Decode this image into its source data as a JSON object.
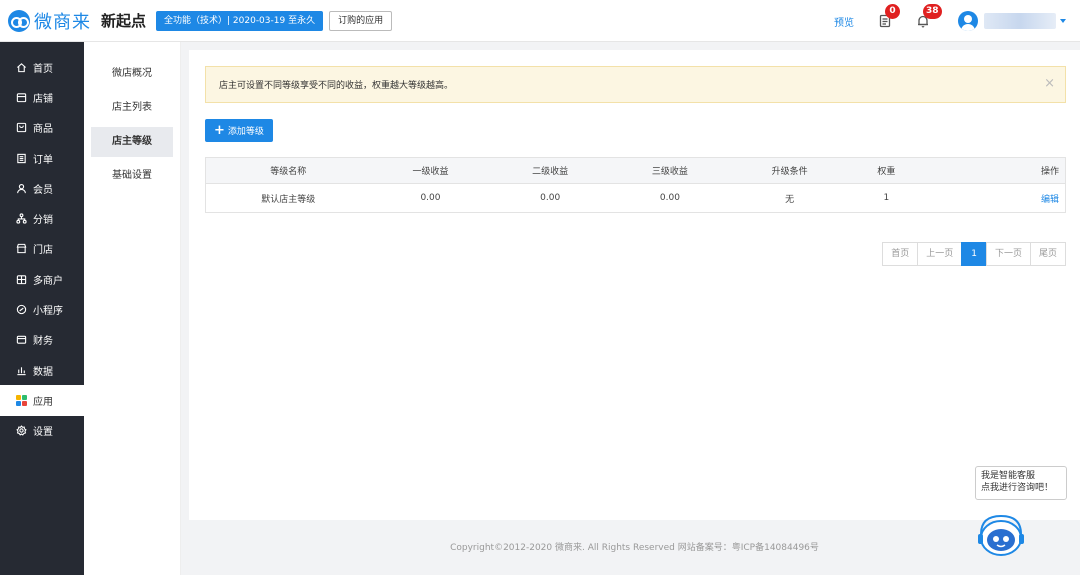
{
  "header": {
    "logo_text": "微商来",
    "brand": "新起点",
    "plan_badge": "全功能（技术）| 2020-03-19 至永久",
    "purchased_apps": "订购的应用",
    "preview": "预览",
    "notes_count": "0",
    "bell_count": "38"
  },
  "sidebar": {
    "items": [
      {
        "label": "首页",
        "icon": "home-icon"
      },
      {
        "label": "店铺",
        "icon": "store-icon"
      },
      {
        "label": "商品",
        "icon": "goods-icon"
      },
      {
        "label": "订单",
        "icon": "order-icon"
      },
      {
        "label": "会员",
        "icon": "member-icon"
      },
      {
        "label": "分销",
        "icon": "distribution-icon"
      },
      {
        "label": "门店",
        "icon": "shop-icon"
      },
      {
        "label": "多商户",
        "icon": "merchant-icon"
      },
      {
        "label": "小程序",
        "icon": "miniprogram-icon"
      },
      {
        "label": "财务",
        "icon": "finance-icon"
      },
      {
        "label": "数据",
        "icon": "data-icon"
      },
      {
        "label": "应用",
        "icon": "apps-icon"
      },
      {
        "label": "设置",
        "icon": "settings-icon"
      }
    ]
  },
  "subnav": {
    "items": [
      "微店概况",
      "店主列表",
      "店主等级",
      "基础设置"
    ],
    "active": "店主等级"
  },
  "main": {
    "alert": "店主可设置不同等级享受不同的收益，权重越大等级越高。",
    "add_button": "添加等级",
    "table": {
      "headers": [
        "等级名称",
        "一级收益",
        "二级收益",
        "三级收益",
        "升级条件",
        "权重",
        "操作"
      ],
      "rows": [
        {
          "name": "默认店主等级",
          "level1": "0.00",
          "level2": "0.00",
          "level3": "0.00",
          "condition": "无",
          "weight": "1",
          "action": "编辑"
        }
      ]
    },
    "pagination": {
      "first": "首页",
      "prev": "上一页",
      "current": "1",
      "next": "下一页",
      "last": "尾页"
    }
  },
  "footer": "Copyright©2012-2020 微商来. All Rights Reserved 网站备案号：粤ICP备14084496号",
  "assistant": {
    "line1": "我是智能客服",
    "line2": "点我进行咨询吧！"
  },
  "colors": {
    "accent": "#1e88e5",
    "sidebar_bg": "#262a33",
    "badge_red": "#e02020",
    "alert_bg": "#fcf6e2"
  }
}
